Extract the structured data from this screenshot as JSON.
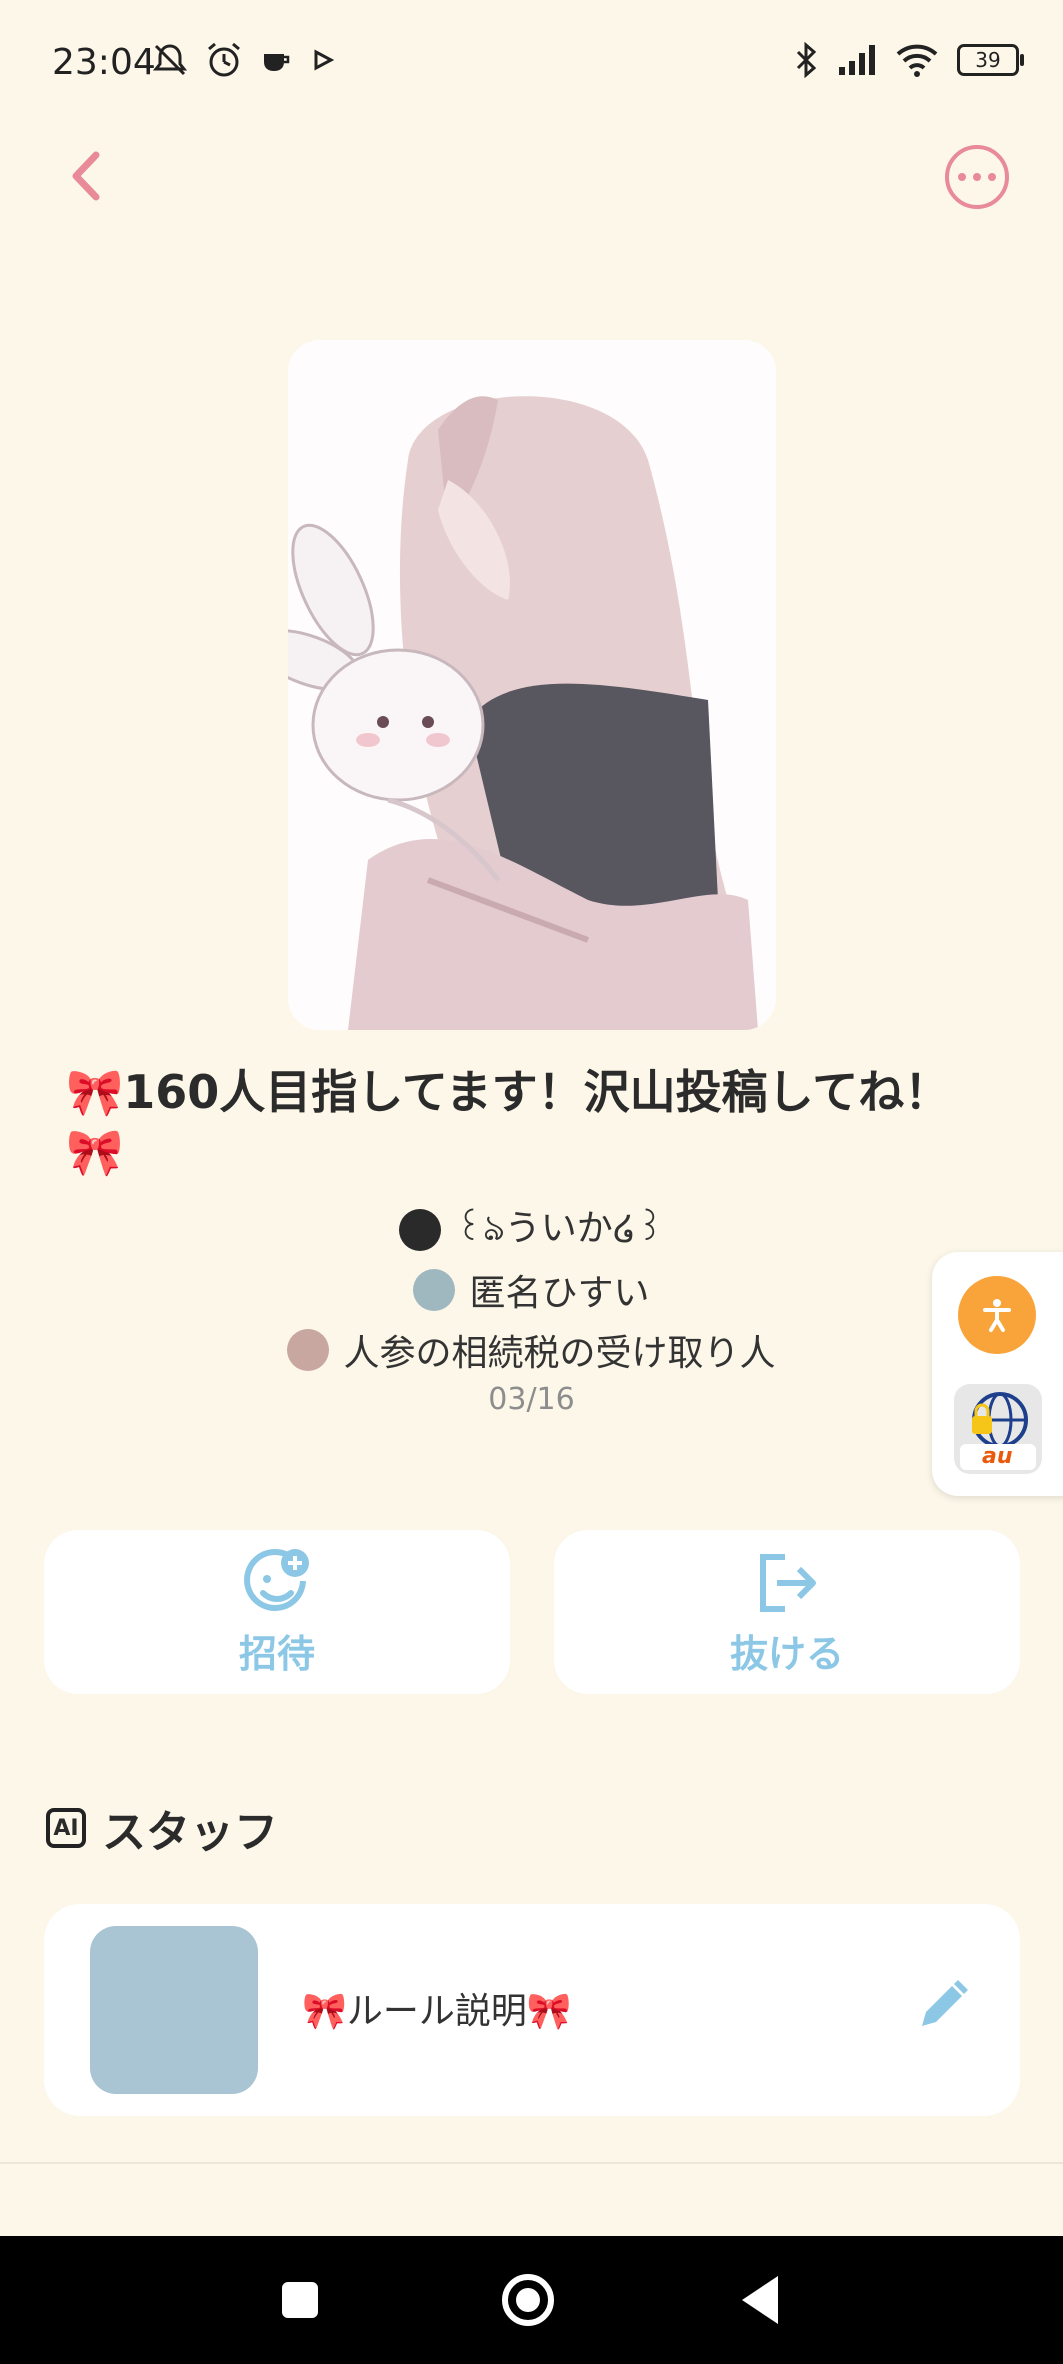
{
  "status_bar": {
    "time": "23:04",
    "battery": "39",
    "icons_left": [
      "mute-icon",
      "alarm-icon",
      "cup-icon",
      "play-icon"
    ],
    "icons_right": [
      "bluetooth-icon",
      "signal-icon",
      "wifi-icon",
      "battery-icon"
    ]
  },
  "header": {
    "back_icon": "chevron-left-icon",
    "more_icon": "more-options-icon",
    "accent": "#e88a97"
  },
  "group": {
    "title": "🎀160人目指してます！沢山投稿してね！🎀",
    "members": [
      {
        "name": "꒰ঌういか໒꒱"
      },
      {
        "name": "匿名ひすい"
      },
      {
        "name": "人参の相続税の受け取り人"
      }
    ],
    "date": "03/16"
  },
  "actions": {
    "invite_label": "招待",
    "leave_label": "抜ける",
    "accent": "#8cc8e6"
  },
  "staff": {
    "section_title": "スタッフ",
    "badge": "AI",
    "items": [
      {
        "name": "🎀ルール説明🎀"
      }
    ]
  },
  "side_widget": {
    "accessibility_icon": "accessibility-icon",
    "au_label": "au"
  },
  "colors": {
    "background": "#fcf7e9",
    "card": "#ffffff"
  }
}
